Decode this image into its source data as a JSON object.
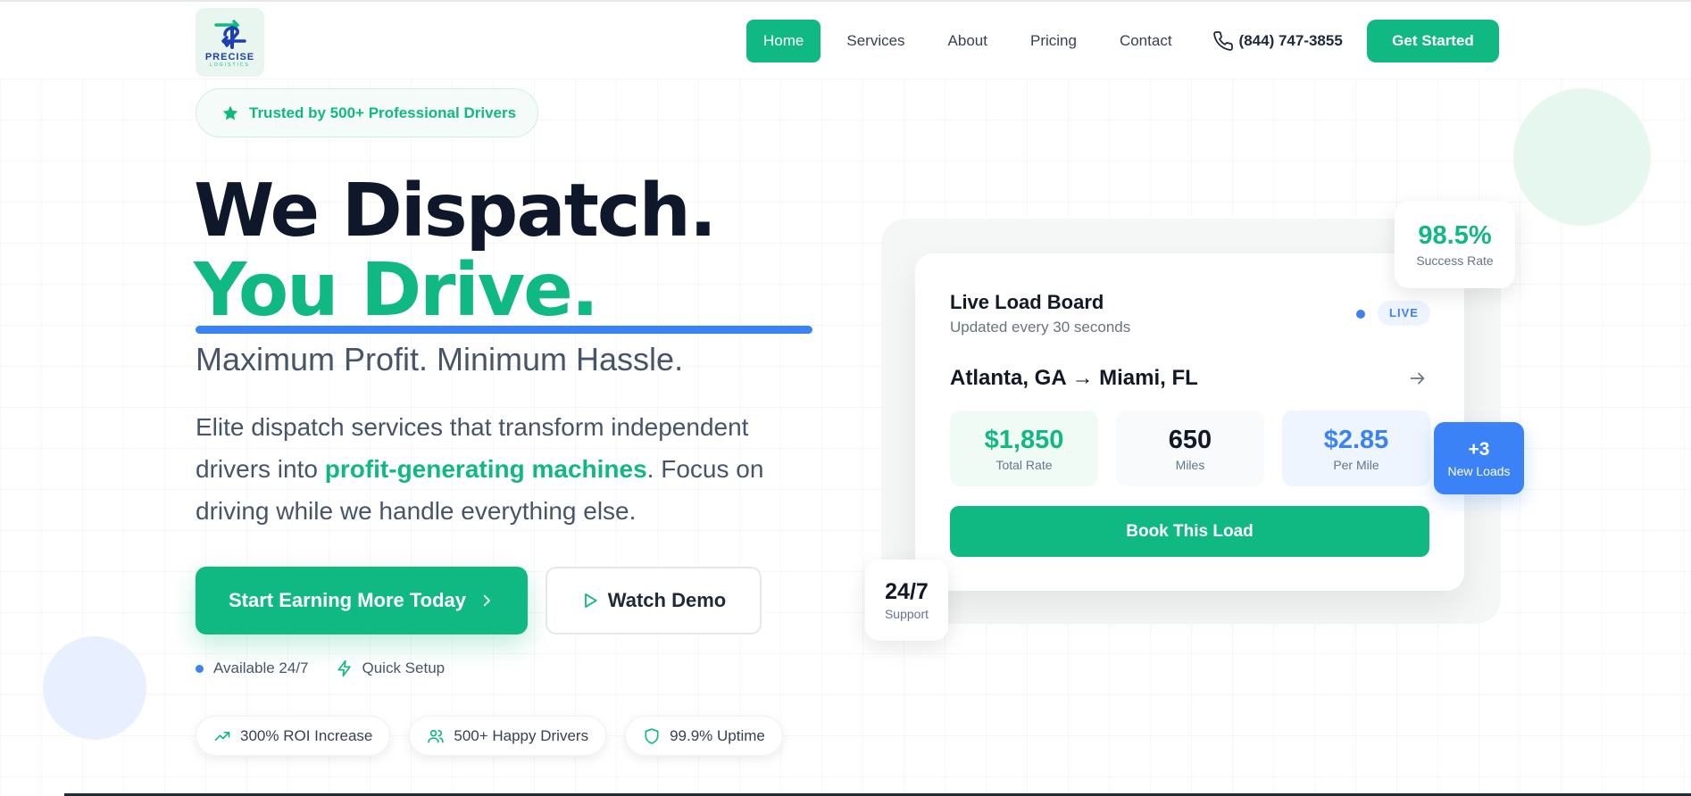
{
  "header": {
    "logo": {
      "word": "PRECISE",
      "sub": "LOGISTICS",
      "icon": "truck-arrows-logo-icon"
    },
    "nav": [
      {
        "label": "Home",
        "active": true
      },
      {
        "label": "Services",
        "active": false
      },
      {
        "label": "About",
        "active": false
      },
      {
        "label": "Pricing",
        "active": false
      },
      {
        "label": "Contact",
        "active": false
      }
    ],
    "phone": {
      "number": "(844) 747-3855",
      "icon": "phone-icon"
    },
    "cta_label": "Get Started"
  },
  "hero": {
    "badge": {
      "text": "Trusted by 500+ Professional Drivers",
      "icon": "star-icon"
    },
    "headline_line1": "We Dispatch.",
    "headline_line2": "You Drive.",
    "subheadline": "Maximum Profit. Minimum Hassle.",
    "description": {
      "before": "Elite dispatch services that transform independent drivers into ",
      "highlight": "profit-generating machines",
      "after": ". Focus on driving while we handle everything else."
    },
    "primary_button": "Start Earning More Today",
    "secondary_button": "Watch Demo",
    "availability": "Available 24/7",
    "quick_setup": "Quick Setup",
    "pills": [
      {
        "label": "300% ROI Increase",
        "icon": "trending-up-icon"
      },
      {
        "label": "500+ Happy Drivers",
        "icon": "users-icon"
      },
      {
        "label": "99.9% Uptime",
        "icon": "shield-icon"
      }
    ]
  },
  "load_board": {
    "title": "Live Load Board",
    "subtitle": "Updated every 30 seconds",
    "live_label": "LIVE",
    "route": "Atlanta, GA → Miami, FL",
    "stats": [
      {
        "value": "$1,850",
        "label": "Total Rate"
      },
      {
        "value": "650",
        "label": "Miles"
      },
      {
        "value": "$2.85",
        "label": "Per Mile"
      }
    ],
    "book_button": "Book This Load"
  },
  "floats": {
    "success": {
      "value": "98.5%",
      "label": "Success Rate"
    },
    "new_loads": {
      "value": "+3",
      "label": "New Loads"
    },
    "support": {
      "value": "24/7",
      "label": "Support"
    }
  },
  "colors": {
    "brand_green": "#10b981",
    "accent_blue": "#3b82f6",
    "headline_dark": "#0f172a"
  }
}
